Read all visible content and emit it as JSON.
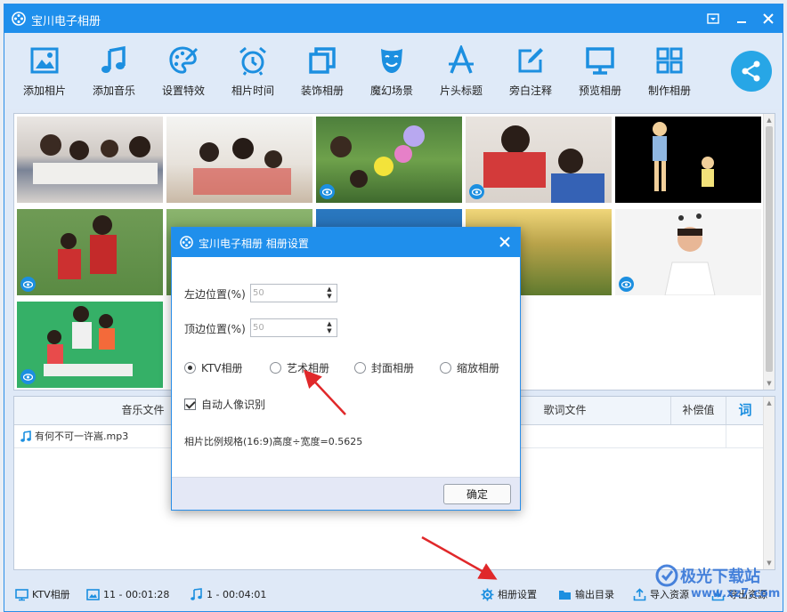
{
  "window": {
    "title": "宝川电子相册"
  },
  "toolbar": {
    "items": [
      {
        "label": "添加相片",
        "icon": "photo-icon"
      },
      {
        "label": "添加音乐",
        "icon": "music-note-icon"
      },
      {
        "label": "设置特效",
        "icon": "palette-icon"
      },
      {
        "label": "相片时间",
        "icon": "alarm-clock-icon"
      },
      {
        "label": "装饰相册",
        "icon": "layers-icon"
      },
      {
        "label": "魔幻场景",
        "icon": "theater-masks-icon"
      },
      {
        "label": "片头标题",
        "icon": "title-a-icon"
      },
      {
        "label": "旁白注释",
        "icon": "edit-note-icon"
      },
      {
        "label": "预览相册",
        "icon": "monitor-icon"
      },
      {
        "label": "制作相册",
        "icon": "grid-icon"
      }
    ],
    "share_icon": "share-icon"
  },
  "music_table": {
    "headers": {
      "music_file": "音乐文件",
      "lyrics_file": "歌词文件",
      "compensation": "补偿值",
      "lyric_btn": "词"
    },
    "rows": [
      {
        "music_file": "有何不可一许嵩.mp3"
      }
    ]
  },
  "status": {
    "mode": "KTV相册",
    "photos": "11 - 00:01:28",
    "music": "1 - 00:04:01",
    "album_settings": "相册设置",
    "output_dir": "输出目录",
    "import": "导入资源",
    "export": "导出资源"
  },
  "dialog": {
    "title": "宝川电子相册  相册设置",
    "left_label": "左边位置(%)",
    "left_value": "50",
    "top_label": "顶边位置(%)",
    "top_value": "50",
    "radios": [
      "KTV相册",
      "艺术相册",
      "封面相册",
      "缩放相册"
    ],
    "selected": "KTV相册",
    "auto_face": "自动人像识别",
    "ratio_text": "相片比例规格(16:9)高度÷宽度=0.5625",
    "ok": "确定"
  },
  "watermark": {
    "text": "极光下载站",
    "url": "www.xz7.com"
  },
  "colors": {
    "titlebar": "#1f8fec",
    "accent": "#1c8fe0",
    "toolbar_bg": "#dfeaf8",
    "arrow": "#e0282a"
  }
}
